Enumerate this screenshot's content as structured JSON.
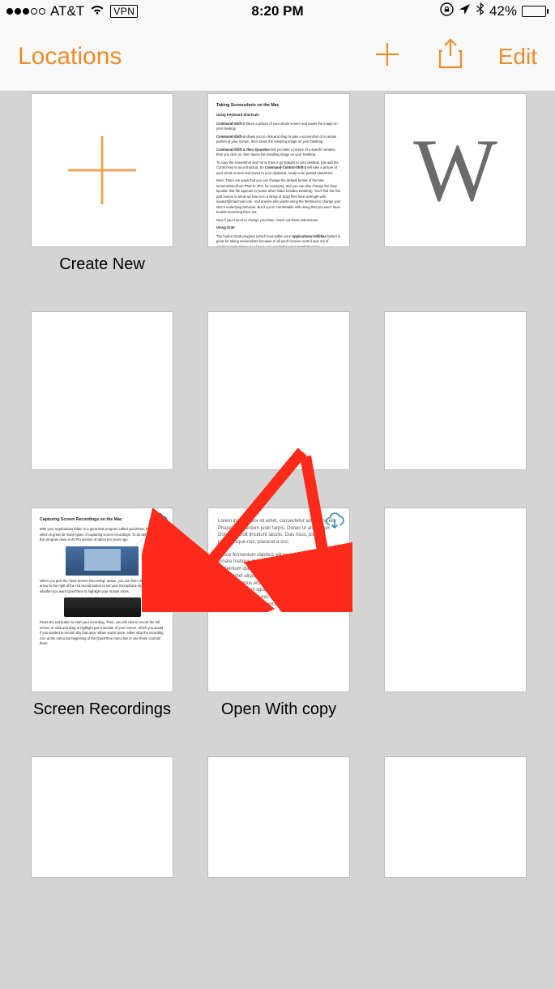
{
  "status": {
    "carrier": "AT&T",
    "vpn": "VPN",
    "time": "8:20 PM",
    "battery_pct": "42%",
    "battery_fill": 42
  },
  "nav": {
    "title": "Locations",
    "edit": "Edit"
  },
  "grid": {
    "create_new": "Create New",
    "w_letter": "W",
    "screen_recordings": "Screen Recordings",
    "open_with_copy": "Open With copy",
    "doc1_title": "Taking Screenshots on the Mac",
    "doc1_sub": "Using Keyboard Shortcuts",
    "doc3_title": "Capturing Screen Recordings on the Mac"
  },
  "lorem": {
    "p1": "Lorem ipsum dolor sit amet, consectetur adipiscing elit. Phasellus interdum justo turpis. Donec ut arcu turpis. Donec blandit tincidunt iaculis. Duis risus, placerat non pellentesque non, placerat a orci.",
    "p2": "Fusce fermentum dapibus elit eu pellentesque. Donec ornare tristique dolor. Nunc rutrum porta sapien, nec fermentum diam rhoncus eu. Curabitur semper auctor leo sit amet aliquet. Sed egestas ultrices fringilla. Sed sodales tempus eros, at pellentesque mi egestas ac. Phasellus at sem ligula. Fusce felis est, aliquet eget mattis in, venenatis nec quam. Integer ac sem eu massa imperdiet tincidunt ut at magna."
  }
}
